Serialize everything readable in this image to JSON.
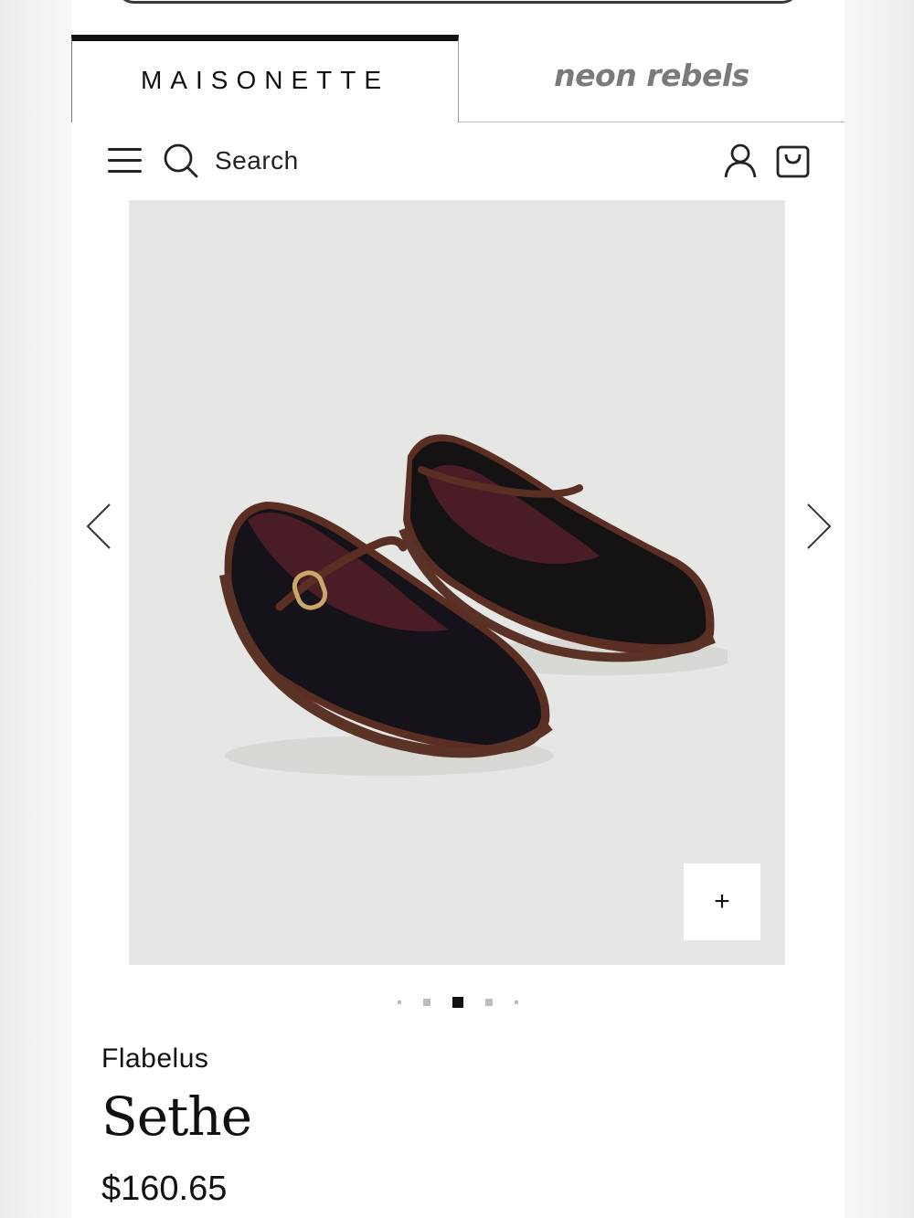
{
  "brand_tabs": [
    {
      "label": "MAISONETTE",
      "active": true
    },
    {
      "label": "neon rebels",
      "active": false
    }
  ],
  "header": {
    "search_label": "Search",
    "icons": [
      "menu-icon",
      "search-icon",
      "account-icon",
      "shopping-bag-icon"
    ]
  },
  "gallery": {
    "zoom_label": "+",
    "image_count": 5,
    "active_index": 2,
    "background_color": "#e6e6e4"
  },
  "product": {
    "brand": "Flabelus",
    "name": "Sethe",
    "price": "$160.65"
  }
}
